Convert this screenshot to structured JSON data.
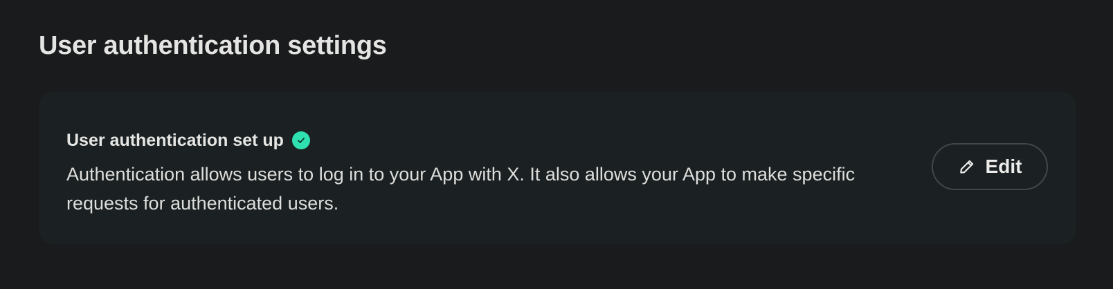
{
  "page": {
    "title": "User authentication settings"
  },
  "card": {
    "title": "User authentication set up",
    "status_icon": "check-circle-icon",
    "description": "Authentication allows users to log in to your App with X. It also allows your App to make specific requests for authenticated users.",
    "edit_button": {
      "label": "Edit",
      "icon": "pencil-icon"
    }
  },
  "colors": {
    "background": "#1a1b1d",
    "card_background": "#1b2122",
    "success_accent": "#2fe0b0",
    "button_border": "#41484a"
  }
}
